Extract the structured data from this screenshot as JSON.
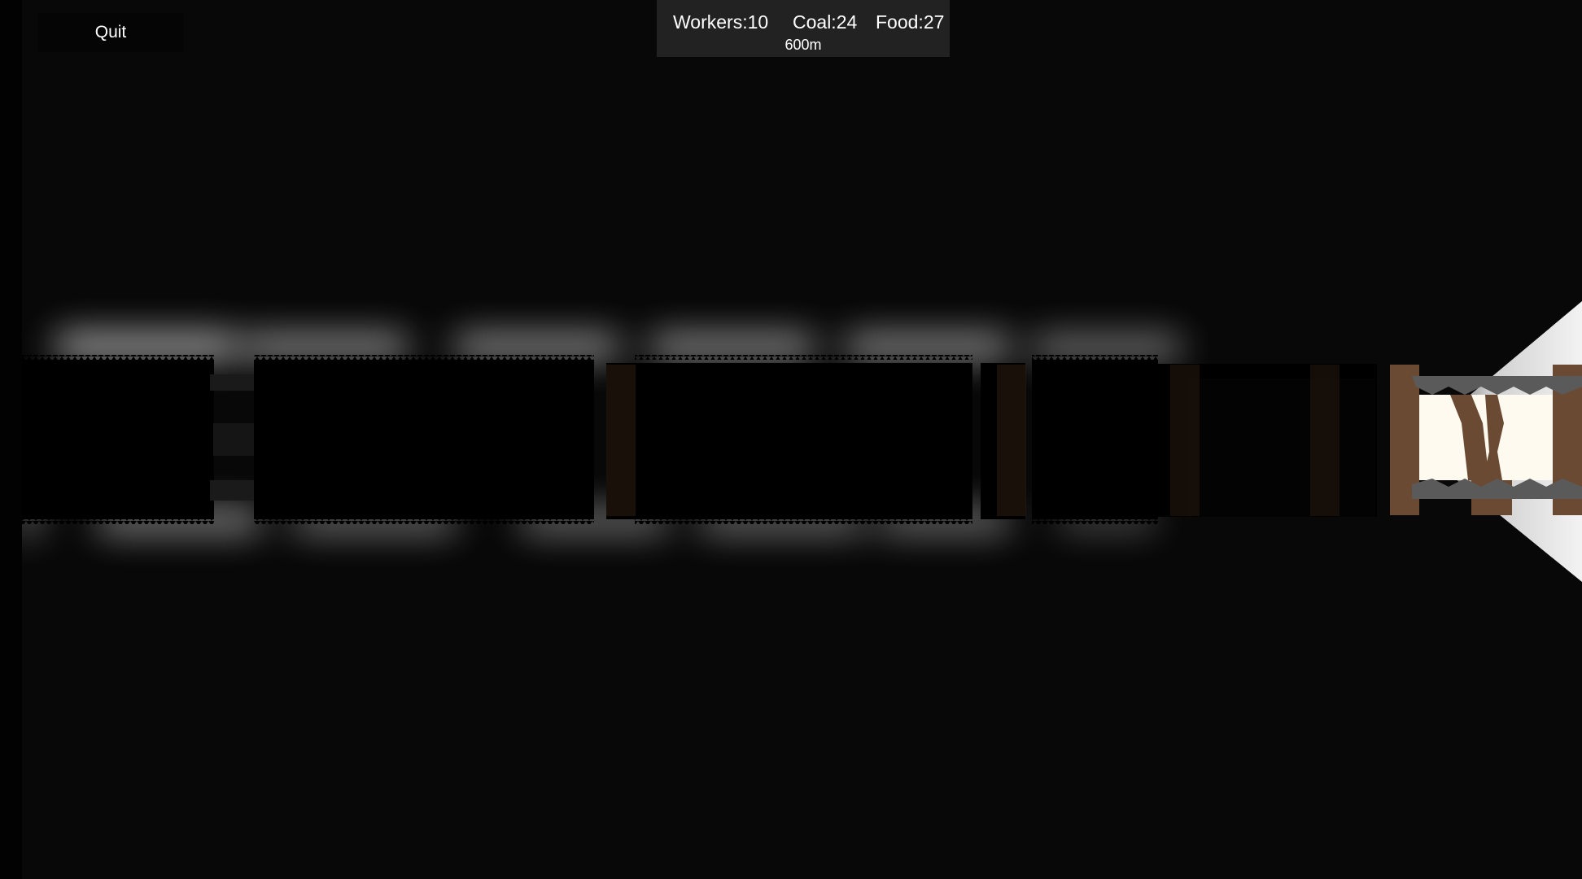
{
  "ui": {
    "quit_label": "Quit"
  },
  "hud": {
    "workers": "Workers:10",
    "coal": "Coal:24",
    "food": "Food:27",
    "depth": "600m"
  },
  "scene": {
    "colors": {
      "background": "#080808",
      "tunnel_glow": "#ffffff",
      "rock": "#000000",
      "wood_support": "#6b4a33",
      "rock_edge": "#555555"
    }
  }
}
